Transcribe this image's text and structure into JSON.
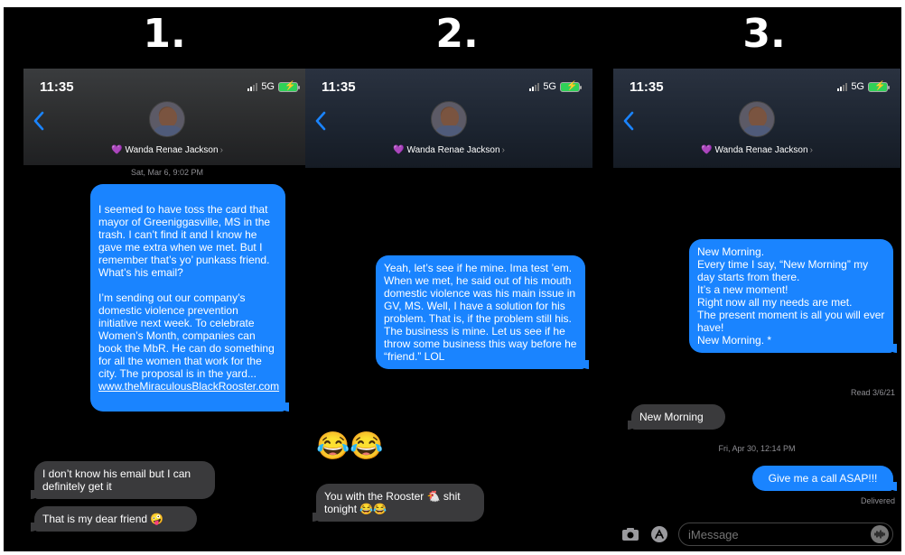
{
  "panels": [
    {
      "number": "1.",
      "time": "11:35",
      "network": "5G",
      "contact": "Wanda Renae Jackson",
      "timestamp": "Sat, Mar 6, 9:02 PM",
      "outgoing": "I seemed to have toss the card that mayor of Greeniggasville, MS in the trash. I can’t find it and I know he gave me extra when we met. But I remember that’s yo’ punkass friend. What’s his email?\n\nI’m sending out our company’s domestic violence prevention initiative next week. To celebrate Women’s Month, companies can book the MbR. He can do something for all the women that work for the city. The proposal is in the yard...",
      "link": "www.theMiraculousBlackRooster.com",
      "incoming": [
        "I don’t know his email but I can definitely get it",
        "That is my dear friend 🤪"
      ]
    },
    {
      "number": "2.",
      "time": "11:35",
      "network": "5G",
      "contact": "Wanda Renae Jackson",
      "outgoing": "Yeah, let’s see if he mine. Ima test ’em. When we met, he said out of his mouth domestic violence was his main issue in GV, MS. Well, I have a solution for his problem. That is, if the problem still his. The business is mine. Let us see if he throw some business this way before he “friend.” LOL",
      "emoji": "😂😂",
      "incoming": "You with the Rooster 🐔 shit tonight 😂😂"
    },
    {
      "number": "3.",
      "time": "11:35",
      "network": "5G",
      "contact": "Wanda Renae Jackson",
      "outgoing": "New Morning.\nEvery time I say, “New Morning” my day starts from there.\nIt’s a new moment!\nRight now all my needs are met.\nThe present moment is all you will ever have!\nNew Morning. *",
      "read": "Read 3/6/21",
      "incoming": "New Morning",
      "timestamp": "Fri, Apr 30, 12:14 PM",
      "outgoing2": "Give me a call ASAP!!!",
      "delivered": "Delivered",
      "placeholder": "iMessage"
    }
  ],
  "colors": {
    "outgoing_bubble": "#1a84ff",
    "incoming_bubble": "#3a3a3c",
    "background": "#000000",
    "heart": "#b45bd8"
  },
  "icons": [
    "back-chevron-icon",
    "heart-icon",
    "signal-icon",
    "battery-icon",
    "camera-icon",
    "app-store-icon",
    "audio-icon"
  ]
}
